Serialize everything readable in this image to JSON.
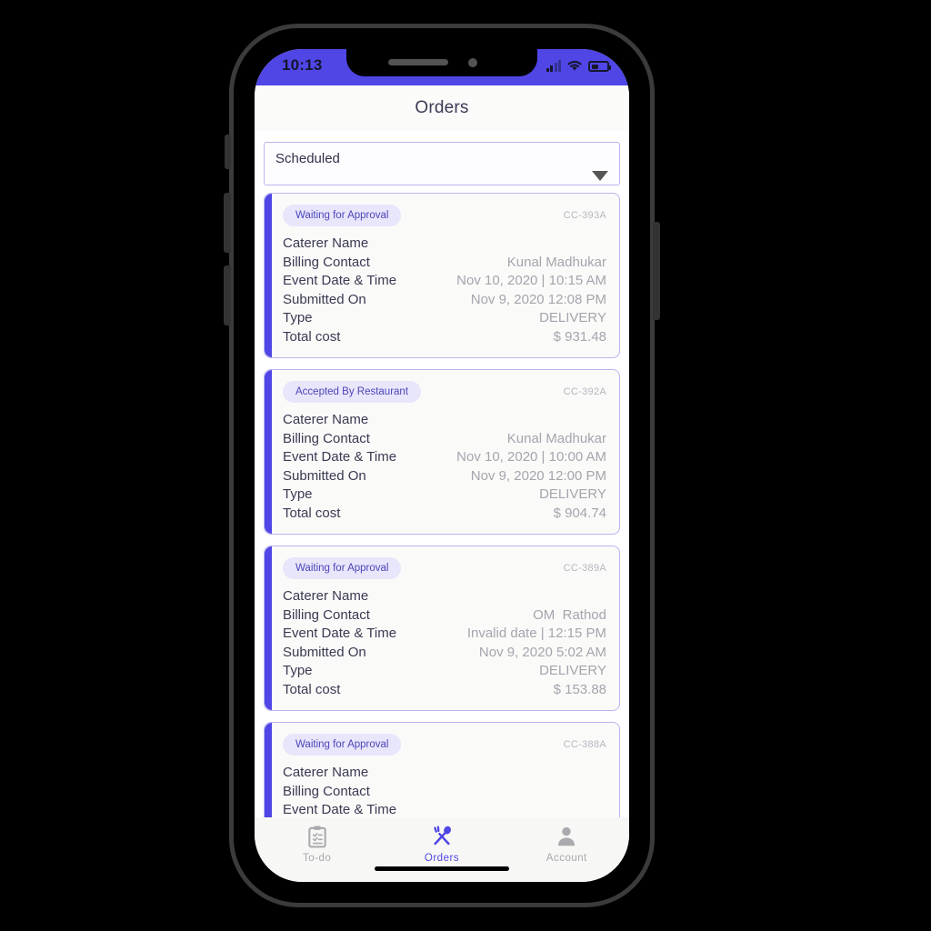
{
  "device": {
    "status_bar": {
      "time": "10:13",
      "icons": [
        "signal-icon",
        "wifi-icon",
        "battery-icon"
      ]
    },
    "home_indicator": "home-indicator"
  },
  "header": {
    "title": "Orders"
  },
  "filter": {
    "selected": "Scheduled",
    "caret": "chevron-down-icon"
  },
  "row_labels": {
    "caterer": "Caterer Name",
    "billing": "Billing Contact",
    "event": "Event Date & Time",
    "submitted": "Submitted On",
    "type": "Type",
    "total": "Total cost"
  },
  "orders": [
    {
      "status": "Waiting for Approval",
      "id": "CC-393A",
      "caterer_name": "",
      "billing_contact": "Kunal Madhukar",
      "event_date_time": "Nov 10, 2020 | 10:15 AM",
      "submitted_on": "Nov 9, 2020 12:08 PM",
      "type": "DELIVERY",
      "total_cost": "$ 931.48"
    },
    {
      "status": "Accepted By Restaurant",
      "id": "CC-392A",
      "caterer_name": "",
      "billing_contact": "Kunal Madhukar",
      "event_date_time": "Nov 10, 2020 | 10:00 AM",
      "submitted_on": "Nov 9, 2020 12:00 PM",
      "type": "DELIVERY",
      "total_cost": "$ 904.74"
    },
    {
      "status": "Waiting for Approval",
      "id": "CC-389A",
      "caterer_name": "",
      "billing_contact": "OM  Rathod",
      "event_date_time": "Invalid date | 12:15 PM",
      "submitted_on": "Nov 9, 2020 5:02 AM",
      "type": "DELIVERY",
      "total_cost": "$ 153.88"
    },
    {
      "status": "Waiting for Approval",
      "id": "CC-388A",
      "caterer_name": "",
      "billing_contact": "",
      "event_date_time": "",
      "submitted_on": "",
      "type": "",
      "total_cost": ""
    }
  ],
  "tabbar": {
    "items": [
      {
        "label": "To-do",
        "icon": "clipboard-icon",
        "active": false
      },
      {
        "label": "Orders",
        "icon": "fork-spoon-icon",
        "active": true
      },
      {
        "label": "Account",
        "icon": "person-icon",
        "active": false
      }
    ]
  },
  "colors": {
    "accent": "#4f46e5",
    "badge_bg": "#e8e6fb",
    "badge_text": "#4b45b8",
    "card_border": "#b9b5ee",
    "value_text": "#a5a5ad",
    "label_text": "#3a3a52",
    "inactive_tab": "#a9a9ae"
  }
}
